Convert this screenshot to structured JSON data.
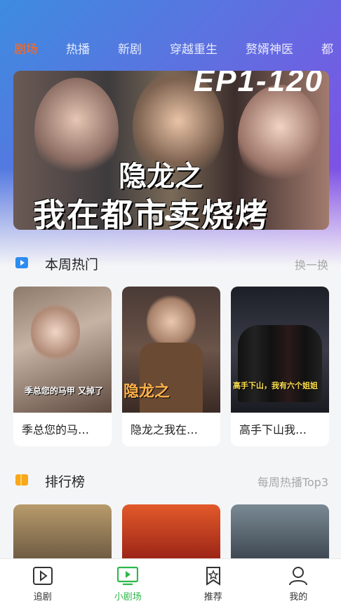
{
  "tabs": [
    {
      "label": "剧场",
      "active": true
    },
    {
      "label": "热播",
      "active": false
    },
    {
      "label": "新剧",
      "active": false
    },
    {
      "label": "穿越重生",
      "active": false
    },
    {
      "label": "赘婿神医",
      "active": false
    },
    {
      "label": "都",
      "active": false
    }
  ],
  "banner": {
    "episode_text": "EP1-120",
    "title_line1": "隐龙之",
    "title_line2": "我在都市卖烧烤",
    "carousel_total": 3,
    "carousel_active": 2
  },
  "weekly_hot": {
    "title": "本周热门",
    "more": "换一换",
    "icon": "play-square-icon",
    "items": [
      {
        "name": "季总您的马…",
        "poster_caption": "季总您的马甲 又掉了"
      },
      {
        "name": "隐龙之我在…",
        "poster_caption": "隐龙之"
      },
      {
        "name": "高手下山我…",
        "poster_caption": "高手下山，我有六个姐姐"
      }
    ]
  },
  "ranking": {
    "title": "排行榜",
    "more": "每周热播Top3",
    "icon": "bookmark-icon"
  },
  "bottom_nav": [
    {
      "label": "追剧",
      "icon": "play-square-icon",
      "active": false
    },
    {
      "label": "小剧场",
      "icon": "tv-icon",
      "active": true
    },
    {
      "label": "推荐",
      "icon": "star-bookmark-icon",
      "active": false
    },
    {
      "label": "我的",
      "icon": "user-icon",
      "active": false
    }
  ],
  "colors": {
    "accent_tab": "#ff6a1f",
    "active_nav": "#2db84a",
    "header_gradient_start": "#3d8ce0",
    "header_gradient_end": "#8a46e6"
  }
}
